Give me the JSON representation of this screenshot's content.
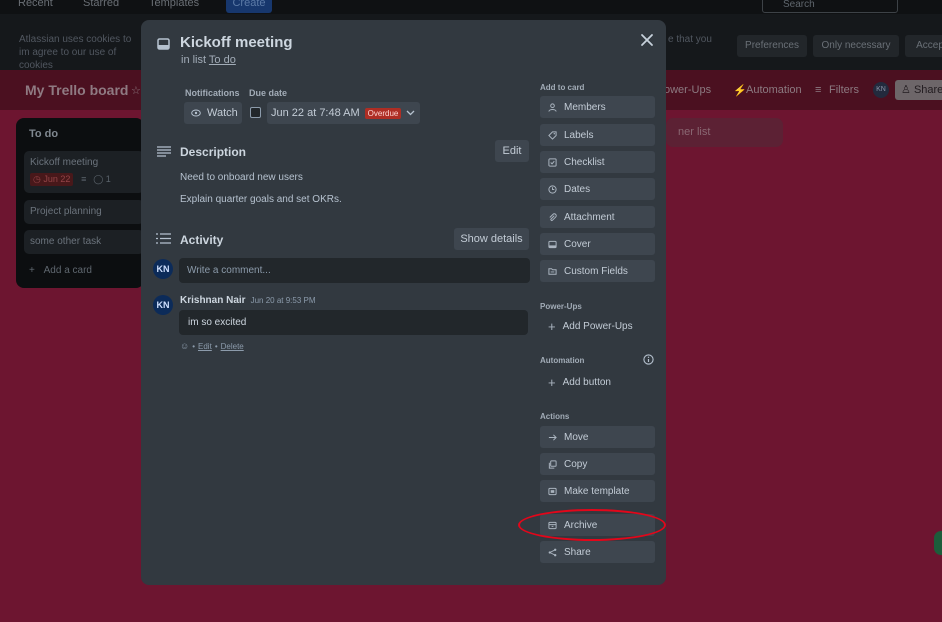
{
  "topbar": {
    "recent": "Recent",
    "starred": "Starred",
    "templates": "Templates",
    "create": "Create",
    "search_placeholder": "Search"
  },
  "cookie_banner": {
    "text_left": "Atlassian uses cookies to im agree to our use of cookies",
    "text_right": "e that you",
    "preferences": "Preferences",
    "only_necessary": "Only necessary",
    "accept": "Accep"
  },
  "board": {
    "title": "My Trello board",
    "power_ups": "ower-Ups",
    "automation": "Automation",
    "filters": "Filters",
    "avatar": "KN",
    "share": "Share",
    "add_list_ghost": "ner list"
  },
  "list": {
    "title": "To do",
    "cards": [
      {
        "title": "Kickoff meeting",
        "due": "Jun 22",
        "comments": "1"
      },
      {
        "title": "Project planning"
      },
      {
        "title": "some other task"
      }
    ],
    "add_card": "Add a card"
  },
  "modal": {
    "title": "Kickoff meeting",
    "in_list_prefix": "in list",
    "list_name": "To do",
    "notifications_label": "Notifications",
    "due_date_label": "Due date",
    "watch_label": "Watch",
    "due_value": "Jun 22 at 7:48 AM",
    "overdue_badge": "Overdue",
    "description_title": "Description",
    "edit_label": "Edit",
    "description_lines": [
      "Need to onboard new users",
      "Explain quarter goals and set OKRs."
    ],
    "activity_title": "Activity",
    "show_details": "Show details",
    "user_initials": "KN",
    "comment_placeholder": "Write a comment...",
    "comment": {
      "author": "Krishnan Nair",
      "time": "Jun 20 at 9:53 PM",
      "text": "im so excited",
      "edit": "Edit",
      "delete": "Delete",
      "sep": "•"
    }
  },
  "sidebar": {
    "add_to_card": "Add to card",
    "add_items": [
      "Members",
      "Labels",
      "Checklist",
      "Dates",
      "Attachment",
      "Cover",
      "Custom Fields"
    ],
    "power_ups": "Power-Ups",
    "add_power_ups": "Add Power-Ups",
    "automation": "Automation",
    "add_button": "Add button",
    "actions": "Actions",
    "action_items": [
      "Move",
      "Copy",
      "Make template",
      "Archive",
      "Share"
    ]
  },
  "colors": {
    "modal_bg": "#323940",
    "button_bg": "#3e464f",
    "overdue": "#ae2e24",
    "highlight": "#e3061a",
    "board_bg": "#6d1530"
  }
}
